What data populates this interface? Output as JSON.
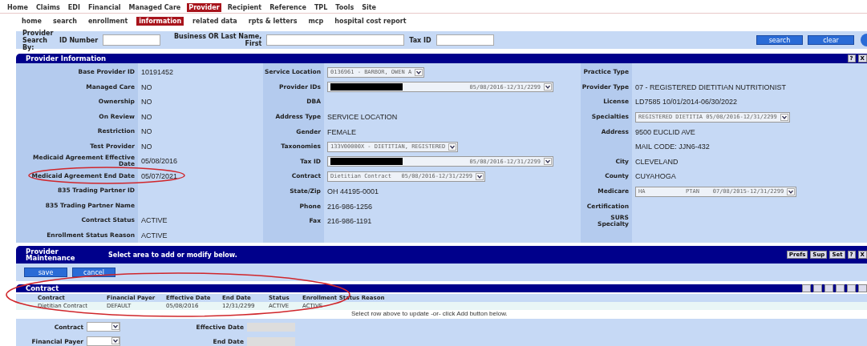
{
  "menu": [
    {
      "label": "Home",
      "selected": false
    },
    {
      "label": "Claims",
      "selected": false
    },
    {
      "label": "EDI",
      "selected": false
    },
    {
      "label": "Financial",
      "selected": false
    },
    {
      "label": "Managed Care",
      "selected": false
    },
    {
      "label": "Provider",
      "selected": true
    },
    {
      "label": "Recipient",
      "selected": false
    },
    {
      "label": "Reference",
      "selected": false
    },
    {
      "label": "TPL",
      "selected": false
    },
    {
      "label": "Tools",
      "selected": false
    },
    {
      "label": "Site",
      "selected": false
    }
  ],
  "submenu": [
    {
      "label": "home",
      "selected": false
    },
    {
      "label": "search",
      "selected": false
    },
    {
      "label": "enrollment",
      "selected": false
    },
    {
      "label": "information",
      "selected": true
    },
    {
      "label": "related data",
      "selected": false
    },
    {
      "label": "rpts & letters",
      "selected": false
    },
    {
      "label": "mcp",
      "selected": false
    },
    {
      "label": "hospital cost report",
      "selected": false
    }
  ],
  "search": {
    "label": "Provider Search By:",
    "fields": [
      {
        "label": "ID Number"
      },
      {
        "label": "Business OR Last Name, First"
      },
      {
        "label": "Tax ID"
      }
    ],
    "buttons": [
      "search",
      "clear"
    ]
  },
  "provider_info": {
    "title": "Provider Information",
    "header_buttons": [
      "?",
      "X"
    ],
    "columns": [
      [
        {
          "label": "Base Provider ID",
          "kind": "text",
          "value": "10191452"
        },
        {
          "label": "Managed Care",
          "kind": "text",
          "value": "NO"
        },
        {
          "label": "Ownership",
          "kind": "text",
          "value": "NO"
        },
        {
          "label": "On Review",
          "kind": "text",
          "value": "NO"
        },
        {
          "label": "Restriction",
          "kind": "text",
          "value": "NO"
        },
        {
          "label": "Test Provider",
          "kind": "text",
          "value": "NO"
        },
        {
          "label": "Medicaid Agreement Effective Date",
          "kind": "text",
          "value": "05/08/2016"
        },
        {
          "label": "Medicaid Agreement End Date",
          "kind": "text",
          "value": "05/07/2021"
        },
        {
          "label": "835 Trading Partner ID",
          "kind": "text"
        },
        {
          "label": "835 Trading Partner Name",
          "kind": "text"
        },
        {
          "label": "Contract Status",
          "kind": "text",
          "value": "ACTIVE"
        },
        {
          "label": "Enrollment Status Reason",
          "kind": "text",
          "value": "ACTIVE"
        }
      ],
      [
        {
          "label": "Service Location",
          "kind": "select",
          "value": "0136961 - BARBOR, OWEN A"
        },
        {
          "label": "Provider IDs",
          "kind": "redacted",
          "value": "05/08/2016-12/31/2299"
        },
        {
          "label": "DBA",
          "kind": "text"
        },
        {
          "label": "Address Type",
          "kind": "text",
          "value": "SERVICE LOCATION"
        },
        {
          "label": "Gender",
          "kind": "text",
          "value": "FEMALE"
        },
        {
          "label": "Taxonomies",
          "kind": "select",
          "value": "133V00000X - DIETITIAN, REGISTERED"
        },
        {
          "label": "Tax ID",
          "kind": "redacted",
          "value": "05/08/2016-12/31/2299"
        },
        {
          "label": "Contract",
          "kind": "select",
          "value": "Dietitian Contract   05/08/2016-12/31/2299"
        },
        {
          "label": "State/Zip",
          "kind": "text",
          "value": "OH 44195-0001"
        },
        {
          "label": "Phone",
          "kind": "text",
          "value": "216-986-1256"
        },
        {
          "label": "Fax",
          "kind": "text",
          "value": "216-986-1191"
        }
      ],
      [
        {
          "label": "Practice Type",
          "kind": "text"
        },
        {
          "label": "Provider Type",
          "kind": "text",
          "value": "07 - REGISTERED DIETITIAN NUTRITIONIST"
        },
        {
          "label": "License",
          "kind": "text",
          "value": "LD7585   10/01/2014-06/30/2022"
        },
        {
          "label": "Specialties",
          "kind": "select",
          "value": "REGISTERED DIETITIA 05/08/2016-12/31/2299"
        },
        {
          "label": "Address",
          "kind": "text",
          "value": "9500 EUCLID AVE"
        },
        {
          "kind": "text",
          "value": "MAIL CODE: JJN6-432"
        },
        {
          "label": "City",
          "kind": "text",
          "value": "CLEVELAND"
        },
        {
          "label": "County",
          "kind": "text",
          "value": "CUYAHOGA"
        },
        {
          "label": "Medicare",
          "kind": "select",
          "value": "HA            PTAN    07/08/2015-12/31/2299"
        },
        {
          "label": "Certification",
          "kind": "text"
        },
        {
          "label": "SURS Specialty",
          "kind": "text"
        }
      ]
    ]
  },
  "maintenance": {
    "title": "Provider Maintenance",
    "message": "Select area to add or modify below.",
    "header_buttons": [
      "Prefs",
      "Sup",
      "Set",
      "?",
      "X"
    ],
    "buttons": [
      "save",
      "cancel"
    ]
  },
  "contract": {
    "title": "Contract",
    "columns": [
      "Contract",
      "Financial Payer",
      "Effective Date",
      "End Date",
      "Status",
      "Enrollment Status Reason"
    ],
    "rows": [
      {
        "cells": [
          "Dietitian Contract",
          "DEFAULT",
          "05/08/2016",
          "12/31/2299",
          "ACTIVE",
          "ACTIVE"
        ],
        "selected": false
      }
    ],
    "hint": "Select row above to update -or- click Add button below.",
    "form": [
      {
        "label": "Contract",
        "kind": "select"
      },
      {
        "label": "Effective Date",
        "kind": "text"
      },
      {
        "label": "Financial Payer",
        "kind": "select"
      },
      {
        "label": "End Date",
        "kind": "text"
      }
    ]
  }
}
